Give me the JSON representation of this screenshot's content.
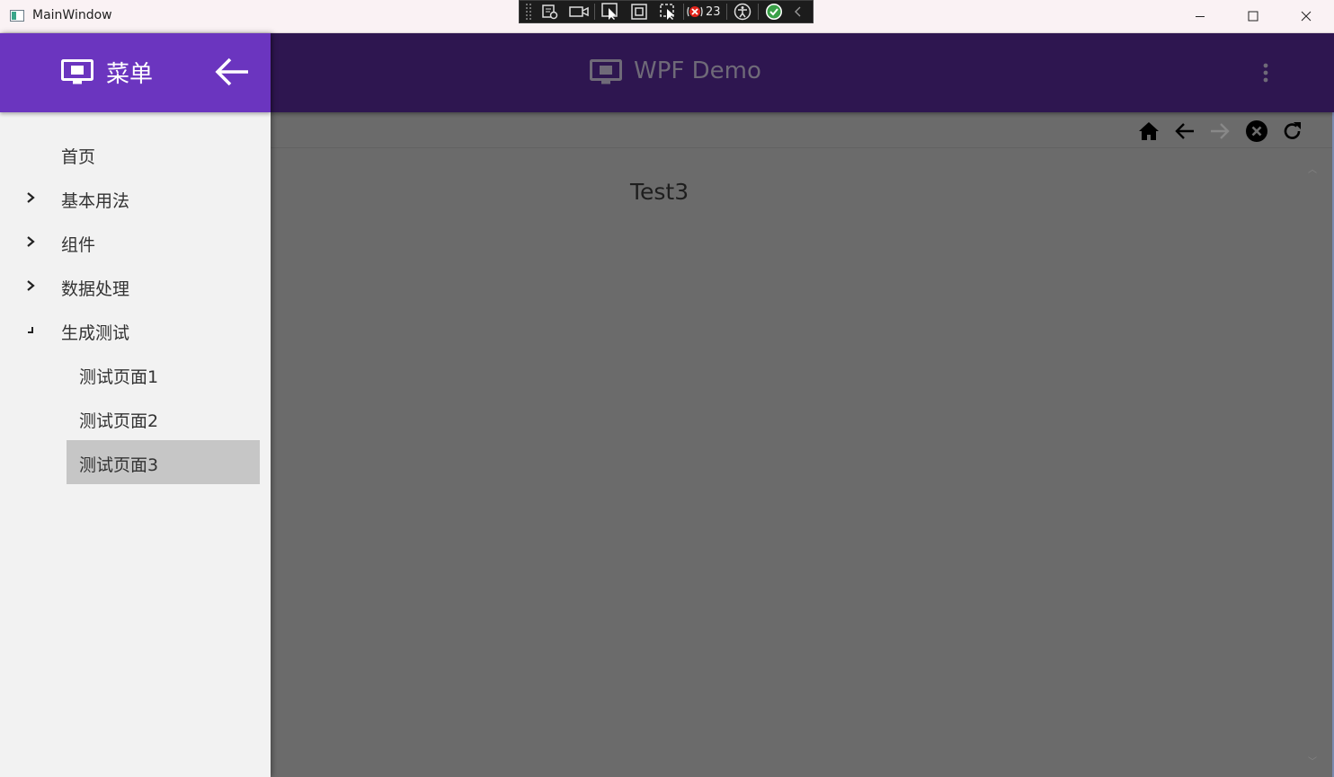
{
  "window": {
    "title": "MainWindow",
    "debug_toolbar": {
      "counter": "23"
    }
  },
  "drawer": {
    "title": "菜单",
    "items": [
      {
        "label": "首页",
        "has_chevron": false
      },
      {
        "label": "基本用法",
        "has_chevron": true
      },
      {
        "label": "组件",
        "has_chevron": true
      },
      {
        "label": "数据处理",
        "has_chevron": true
      },
      {
        "label": "生成测试",
        "expanded": true
      }
    ],
    "subitems": [
      {
        "label": "测试页面1"
      },
      {
        "label": "测试页面2"
      },
      {
        "label": "测试页面3",
        "selected": true
      }
    ]
  },
  "appbar": {
    "title": "WPF Demo"
  },
  "content": {
    "text": "Test3"
  },
  "colors": {
    "drawer_header": "#6b35bf",
    "appbar": "#2e1650",
    "content_bg": "#6b6b6b",
    "selected_item": "#c6c6c6"
  },
  "icons": {
    "appbar": [
      "monitor-icon",
      "more-vert-icon"
    ],
    "navbar": [
      "home-icon",
      "arrow-back-icon",
      "arrow-forward-icon",
      "close-circle-icon",
      "refresh-icon"
    ]
  }
}
